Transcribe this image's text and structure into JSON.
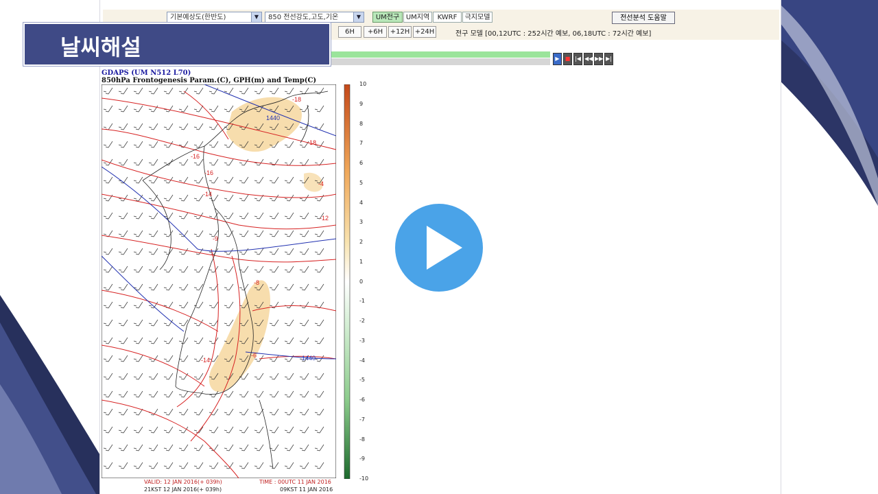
{
  "banner": {
    "title": "날씨해설"
  },
  "toolbar": {
    "left_label": "...",
    "select_region": "기본예상도(한반도)",
    "select_level": "850 전선강도,고도,기온",
    "tabs": [
      {
        "label": "UM전구",
        "active": true
      },
      {
        "label": "UM지역",
        "active": false
      },
      {
        "label": "KWRF",
        "active": false
      },
      {
        "label": "극지모델",
        "active": false
      }
    ],
    "help_label": "전선분석 도움말"
  },
  "step_buttons": [
    "6H",
    "+6H",
    "+12H",
    "+24H"
  ],
  "model_note": "전구 모델 [00,12UTC : 252시간 예보, 06,18UTC : 72시간 예보]",
  "animation_controls": [
    "play",
    "stop",
    "first",
    "prev",
    "next",
    "last"
  ],
  "chart": {
    "source_label": "GDAPS (UM N512 L70)",
    "title": "850hPa Frontogenesis Param.(C), GPH(m) and Temp(C)",
    "contour_labels": [
      "-18",
      "-18",
      "-16",
      "-16",
      "-14",
      "-14",
      "-12",
      "-9",
      "-8",
      "-6",
      "-4",
      "1440",
      "1440"
    ],
    "colorbar_ticks": [
      "10",
      "9",
      "8",
      "7",
      "6",
      "5",
      "4",
      "3",
      "2",
      "1",
      "0",
      "-1",
      "-2",
      "-3",
      "-4",
      "-5",
      "-6",
      "-7",
      "-8",
      "-9",
      "-10"
    ],
    "footer_valid": "VALID: 12 JAN 2016(+ 039h)",
    "footer_valid_kst": "21KST 12 JAN 2016(+ 039h)",
    "footer_time": "TIME : 00UTC 11 JAN 2016",
    "footer_time_kst": "09KST 11 JAN 2016"
  },
  "colors": {
    "banner_bg": "#3f4a86",
    "play_button": "#4aa3e8",
    "active_tab": "#b9e7b9",
    "contour_temp": "#d62020",
    "contour_height": "#2030b0",
    "front_fill": "#f3cf8a"
  },
  "play_icon": "play-icon"
}
